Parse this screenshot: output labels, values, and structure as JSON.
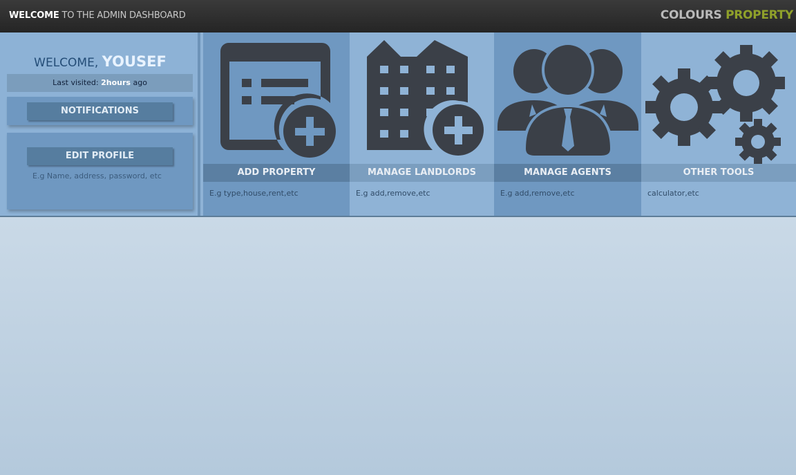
{
  "topbar": {
    "welcome_bold": "WELCOME",
    "welcome_rest": " TO THE ADMIN DASHBOARD",
    "brand_part1": "COLOURS",
    "brand_part2": "PROPERTY"
  },
  "sidebar": {
    "welcome_prefix": "WELCOME, ",
    "user_name": "YOUSEF",
    "last_visited_prefix": "Last visited: ",
    "last_visited_value": "2hours",
    "last_visited_suffix": " ago",
    "notifications_label": "NOTIFICATIONS",
    "edit_profile_label": "EDIT PROFILE",
    "edit_profile_hint": "E.g Name, address, password, etc"
  },
  "tiles": [
    {
      "label": "ADD PROPERTY",
      "desc": "E.g type,house,rent,etc",
      "icon": "add-property-icon"
    },
    {
      "label": "MANAGE LANDLORDS",
      "desc": "E.g add,remove,etc",
      "icon": "building-add-icon"
    },
    {
      "label": "MANAGE AGENTS",
      "desc": "E.g add,remove,etc",
      "icon": "agents-group-icon"
    },
    {
      "label": "OTHER TOOLS",
      "desc": "calculator,etc",
      "icon": "gears-icon"
    }
  ],
  "colors": {
    "topbar": "#2c2c2c",
    "brand_accent": "#8fa02a",
    "tile_light": "#8fb3d6",
    "tile_dark": "#6f98c1",
    "icon": "#3b4048"
  }
}
